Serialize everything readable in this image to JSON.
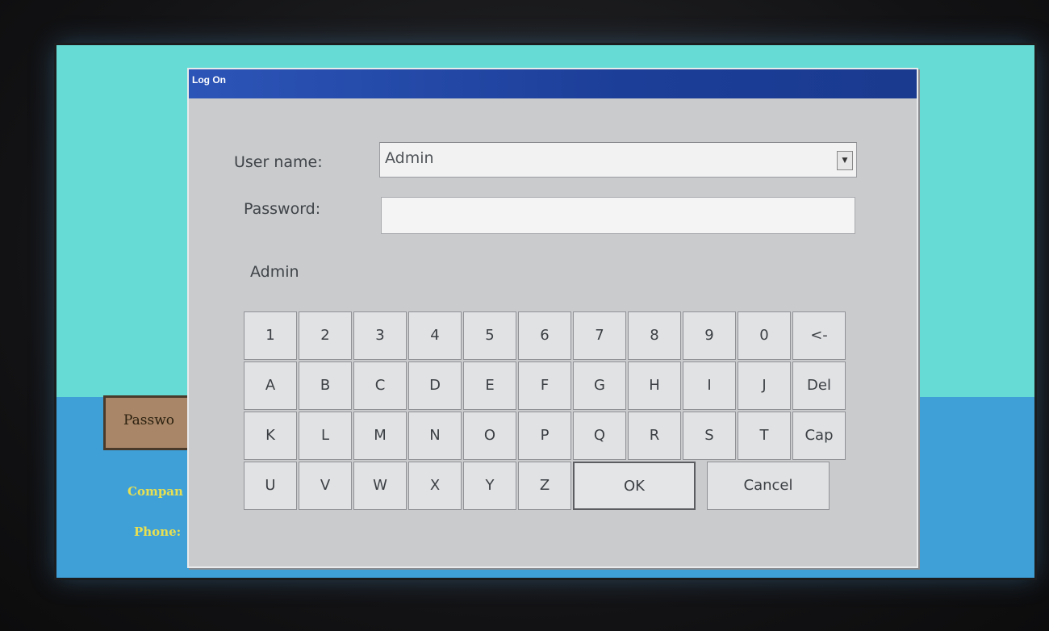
{
  "background": {
    "password_button_label": "Passwo",
    "company_label": "Compan",
    "phone_label": "Phone:"
  },
  "dialog": {
    "title": "Log On",
    "username_label": "User name:",
    "username_value": "Admin",
    "password_label": "Password:",
    "password_value": "",
    "current_user_text": "Admin"
  },
  "keyboard": {
    "row1": [
      "1",
      "2",
      "3",
      "4",
      "5",
      "6",
      "7",
      "8",
      "9",
      "0",
      "<-"
    ],
    "row2": [
      "A",
      "B",
      "C",
      "D",
      "E",
      "F",
      "G",
      "H",
      "I",
      "J",
      "Del"
    ],
    "row3": [
      "K",
      "L",
      "M",
      "N",
      "O",
      "P",
      "Q",
      "R",
      "S",
      "T",
      "Cap"
    ],
    "row4": [
      "U",
      "V",
      "W",
      "X",
      "Y",
      "Z"
    ],
    "ok_label": "OK",
    "cancel_label": "Cancel"
  },
  "icons": {
    "dropdown_arrow": "chevron-down-icon"
  }
}
